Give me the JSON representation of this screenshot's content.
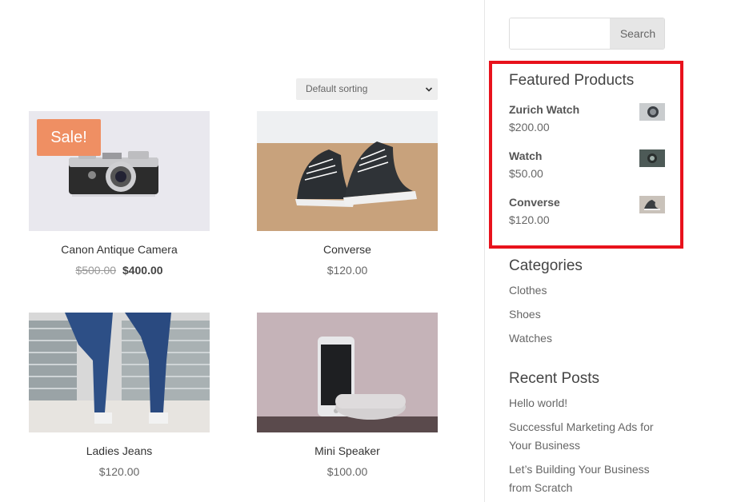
{
  "sorting": {
    "selected": "Default sorting"
  },
  "products": [
    {
      "name": "Canon Antique Camera",
      "old_price": "$500.00",
      "price": "$400.00",
      "badge": "Sale!"
    },
    {
      "name": "Converse",
      "price": "$120.00"
    },
    {
      "name": "Ladies Jeans",
      "price": "$120.00"
    },
    {
      "name": "Mini Speaker",
      "price": "$100.00"
    }
  ],
  "search": {
    "placeholder": "",
    "button_label": "Search"
  },
  "featured": {
    "title": "Featured Products",
    "items": [
      {
        "name": "Zurich Watch",
        "price": "$200.00"
      },
      {
        "name": "Watch",
        "price": "$50.00"
      },
      {
        "name": "Converse",
        "price": "$120.00"
      }
    ]
  },
  "categories": {
    "title": "Categories",
    "items": [
      "Clothes",
      "Shoes",
      "Watches"
    ]
  },
  "recent_posts": {
    "title": "Recent Posts",
    "items": [
      "Hello world!",
      "Successful Marketing Ads for Your Business",
      "Let’s Building Your Business from Scratch"
    ]
  },
  "colors": {
    "sale_badge": "#ef8f63",
    "highlight_border": "#e8121c"
  }
}
